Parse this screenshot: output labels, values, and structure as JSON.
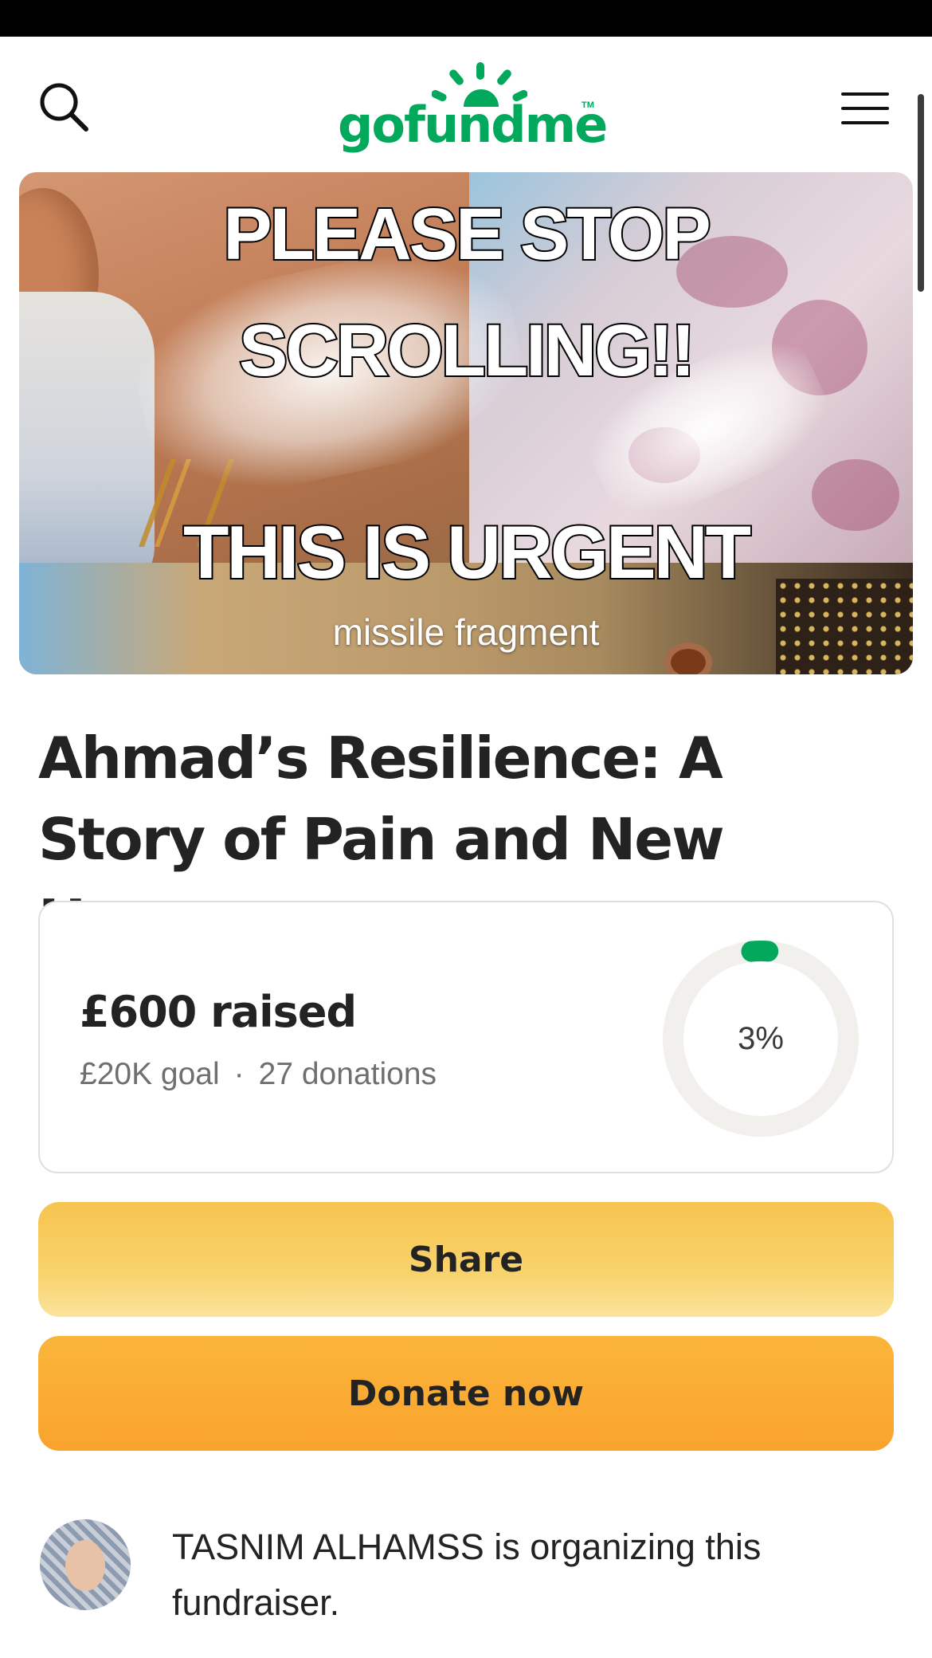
{
  "header": {
    "logo_text": "gofundme",
    "logo_tm": "TM",
    "search_icon": "search-icon",
    "menu_icon": "hamburger-menu-icon"
  },
  "hero": {
    "line1": "PLEASE STOP",
    "line2": "SCROLLING!!",
    "line3": "THIS IS URGENT",
    "caption": "missile fragment"
  },
  "campaign": {
    "title": "Ahmad’s Resilience: A Story of Pain and New Hopes"
  },
  "progress": {
    "raised_text": "£600 raised",
    "goal_text": "£20K goal",
    "separator": "·",
    "donations_text": "27 donations",
    "percent_label": "3%",
    "percent_value": 3,
    "accent_color": "#02a95c",
    "track_color": "#f1f0ec"
  },
  "actions": {
    "share_label": "Share",
    "donate_label": "Donate now",
    "share_color": "#f7c44f",
    "donate_color": "#f9a32d"
  },
  "organizer": {
    "text": "TASNIM ALHAMSS is organizing this fundraiser."
  }
}
